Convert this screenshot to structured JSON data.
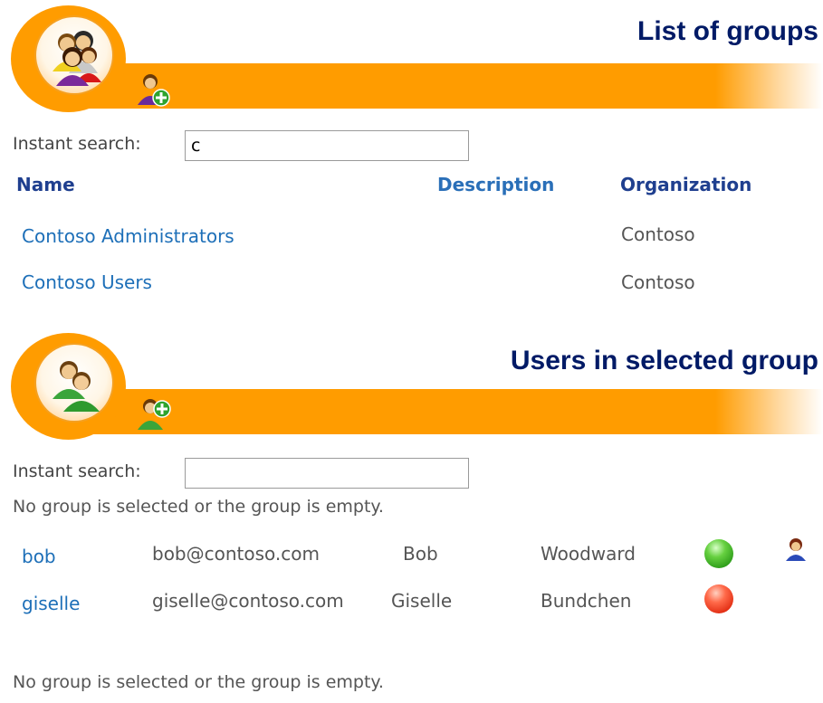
{
  "groups_section": {
    "title": "List of groups",
    "search_label": "Instant search:",
    "search_value": "c",
    "columns": [
      "Name",
      "Description",
      "Organization"
    ],
    "rows": [
      {
        "name": "Contoso Administrators",
        "description": "",
        "organization": "Contoso"
      },
      {
        "name": "Contoso Users",
        "description": "",
        "organization": "Contoso"
      }
    ]
  },
  "users_section": {
    "title": "Users in selected group",
    "search_label": "Instant search:",
    "search_value": "",
    "empty_message": "No group is selected or the group is empty.",
    "rows": [
      {
        "username": "bob",
        "email": "bob@contoso.com",
        "first_name": "Bob",
        "last_name": "Woodward",
        "status": "green",
        "status_icon": "status-green-icon",
        "extra_icon": "user-icon"
      },
      {
        "username": "giselle",
        "email": "giselle@contoso.com",
        "first_name": "Giselle",
        "last_name": "Bundchen",
        "status": "red",
        "status_icon": "status-red-icon",
        "extra_icon": ""
      }
    ],
    "footer_message": "No group is selected or the group is empty."
  },
  "icons": {
    "groups_banner": "group-people-icon",
    "add_group": "add-group-icon",
    "users_banner": "users-icon",
    "add_user": "add-user-icon"
  },
  "colors": {
    "banner_orange": "#ff9c00",
    "title_navy": "#001a66",
    "link_blue": "#1d6fb8",
    "status_green": "#3cb82a",
    "status_red": "#e8341c"
  }
}
